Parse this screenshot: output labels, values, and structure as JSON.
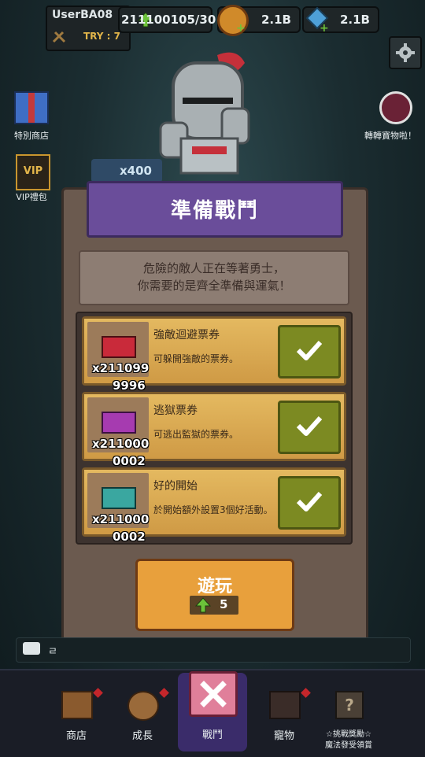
{
  "header": {
    "user_name": "UserBA08",
    "try_label": "TRY : 7",
    "energy": "211100105/30",
    "gold": "2.1B",
    "gems": "2.1B"
  },
  "side_buttons": {
    "special_shop": "特別商店",
    "vip_pack": "VIP禮包",
    "spin_treasure": "轉轉寶物啦！",
    "gem_badge": "x400"
  },
  "modal": {
    "title": "準備戰鬥",
    "intro_line1": "危險的敵人正在等著勇士，",
    "intro_line2": "你需要的是齊全準備與運氣！",
    "items": [
      {
        "name": "強敵迴避票券",
        "desc": "可躲開強敵的票券。",
        "count_line1": "x211099",
        "count_line2": "9996",
        "color": "#c92a3a"
      },
      {
        "name": "逃獄票券",
        "desc": "可逃出監獄的票券。",
        "count_line1": "x211000",
        "count_line2": "0002",
        "color": "#a63bb0"
      },
      {
        "name": "好的開始",
        "desc": "於開始額外設置3個好活動。",
        "count_line1": "x211000",
        "count_line2": "0002",
        "color": "#3aa7a0"
      }
    ],
    "play_label": "遊玩",
    "play_cost": "5"
  },
  "chat": {
    "text": "ㄹ"
  },
  "bottom_nav": [
    {
      "label": "商店"
    },
    {
      "label": "成長"
    },
    {
      "label": "戰鬥"
    },
    {
      "label": "寵物"
    },
    {
      "label": "☆挑戰獎勵☆",
      "label2": "魔法發受領賞"
    }
  ],
  "colors": {
    "accent_purple": "#6a4d9a",
    "check_green": "#7c8a22",
    "play_orange": "#e8a03c"
  }
}
